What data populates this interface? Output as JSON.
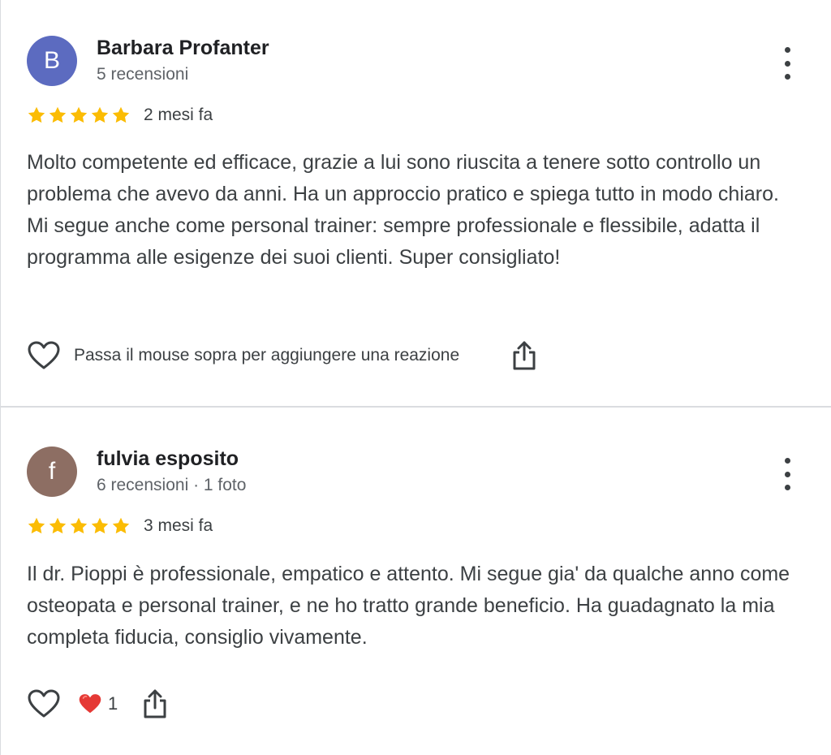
{
  "reviews": [
    {
      "avatar_letter": "B",
      "avatar_color": "#5c6bc0",
      "author": "Barbara Profanter",
      "meta": "5 recensioni",
      "rating": 5,
      "time": "2 mesi fa",
      "text": "Molto competente ed efficace, grazie a lui sono riuscita a tenere sotto controllo un problema che avevo da anni. Ha un approccio pratico e spiega tutto in modo chiaro. Mi segue anche come personal trainer: sempre professionale e flessibile, adatta il programma alle esigenze dei suoi clienti. Super consigliato!",
      "reaction_hint": "Passa il mouse sopra per aggiungere una reazione"
    },
    {
      "avatar_letter": "f",
      "avatar_color": "#8d6e63",
      "author": "fulvia esposito",
      "meta": "6 recensioni · 1 foto",
      "rating": 5,
      "time": "3 mesi fa",
      "text": "Il dr. Pioppi è professionale, empatico e attento. Mi segue gia' da qualche anno come osteopata e personal trainer, e ne ho tratto grande beneficio. Ha guadagnato la mia completa fiducia, consiglio vivamente.",
      "reaction_count": "1"
    }
  ],
  "colors": {
    "star": "#fbbc04",
    "divider": "#dadce0",
    "heart_reaction": "#e53935"
  },
  "icons": {
    "more": "more-vert-icon",
    "heart": "heart-outline-icon",
    "share": "share-icon",
    "reaction": "red-heart-icon",
    "star": "star-icon"
  }
}
